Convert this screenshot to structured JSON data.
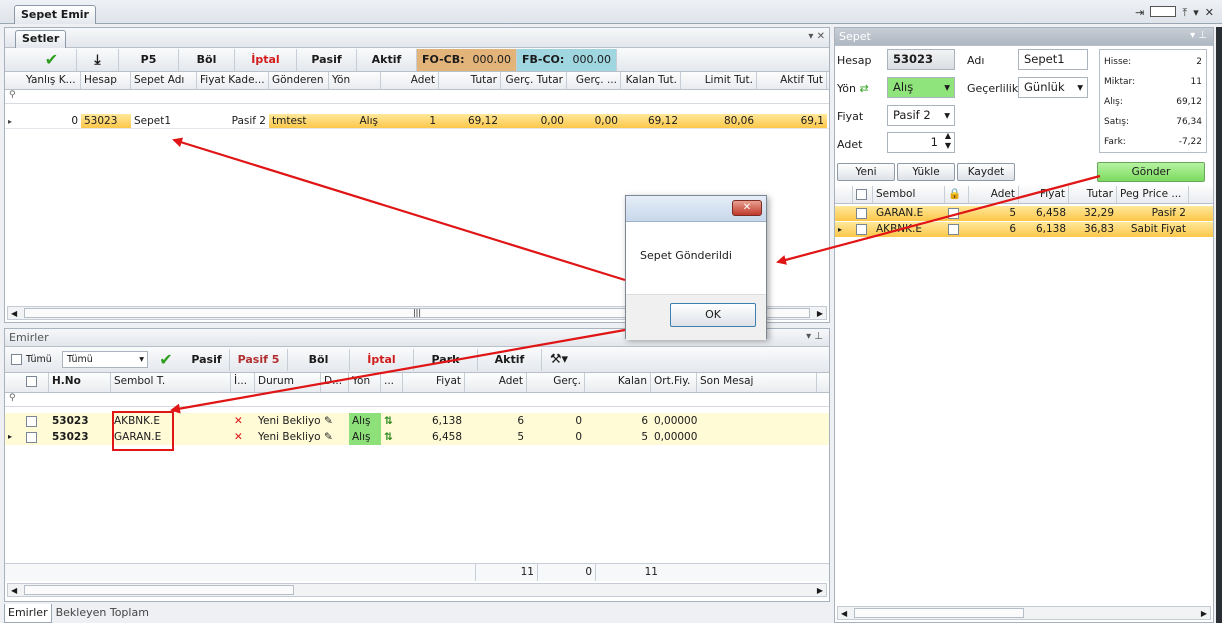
{
  "window": {
    "tab": "Sepet Emir"
  },
  "setler": {
    "title": "Setler",
    "toolbar": [
      "P5",
      "Böl",
      "İptal",
      "Pasif",
      "Aktif"
    ],
    "fo_cb_label": "FO-CB:",
    "fo_cb_value": "000.00",
    "fb_co_label": "FB-CO:",
    "fb_co_value": "000.00",
    "columns": [
      "Yanlış K...",
      "Hesap",
      "Sepet Adı",
      "Fiyat Kade...",
      "Gönderen",
      "Yön",
      "Adet",
      "Tutar",
      "Gerç. Tutar",
      "Gerç. ...",
      "Kalan Tut.",
      "Limit Tut.",
      "Aktif Tut"
    ],
    "row": [
      "0",
      "53023",
      "Sepet1",
      "Pasif 2",
      "tmtest",
      "Alış",
      "1",
      "69,12",
      "0,00",
      "0,00",
      "69,12",
      "80,06",
      "69,1"
    ]
  },
  "emirler": {
    "title": "Emirler",
    "tumu_label": "Tümü",
    "tumu_select": "Tümü",
    "toolbar": [
      "Pasif",
      "Pasif 5",
      "Böl",
      "İptal",
      "Park",
      "Aktif"
    ],
    "columns": [
      "H.No",
      "Sembol T.",
      "İ...",
      "Durum",
      "D...",
      "Yön",
      "...",
      "Fiyat",
      "Adet",
      "Gerç.",
      "Kalan",
      "Ort.Fiy.",
      "Son Mesaj"
    ],
    "rows": [
      [
        "53023",
        "AKBNK.E",
        "Yeni Bekliyor",
        "Alış",
        "6,138",
        "6",
        "0",
        "6",
        "0,00000"
      ],
      [
        "53023",
        "GARAN.E",
        "Yeni Bekliyor",
        "Alış",
        "6,458",
        "5",
        "0",
        "5",
        "0,00000"
      ]
    ],
    "totals": [
      "11",
      "0",
      "11"
    ],
    "bottom_tabs": [
      "Emirler",
      "Bekleyen Toplam"
    ]
  },
  "sepet": {
    "title": "Sepet",
    "hesap_label": "Hesap",
    "hesap_value": "53023",
    "adi_label": "Adı",
    "adi_value": "Sepet1",
    "yon_label": "Yön",
    "yon_value": "Alış",
    "gecerlilik_label": "Geçerlilik",
    "gecerlilik_value": "Günlük",
    "fiyat_label": "Fiyat",
    "fiyat_value": "Pasif 2",
    "adet_label": "Adet",
    "adet_value": "1",
    "summary": [
      {
        "k": "Hisse:",
        "v": "2"
      },
      {
        "k": "Miktar:",
        "v": "11"
      },
      {
        "k": "Alış:",
        "v": "69,12"
      },
      {
        "k": "Satış:",
        "v": "76,34"
      },
      {
        "k": "Fark:",
        "v": "-7,22"
      }
    ],
    "buttons": [
      "Yeni",
      "Yükle",
      "Kaydet"
    ],
    "send": "Gönder",
    "columns": [
      "Sembol",
      "Adet",
      "Fiyat",
      "Tutar",
      "Peg Price ..."
    ],
    "rows": [
      [
        "GARAN.E",
        "5",
        "6,458",
        "32,29",
        "Pasif 2"
      ],
      [
        "AKBNK.E",
        "6",
        "6,138",
        "36,83",
        "Sabit Fiyat"
      ]
    ]
  },
  "dialog": {
    "message": "Sepet Gönderildi",
    "ok": "OK"
  }
}
